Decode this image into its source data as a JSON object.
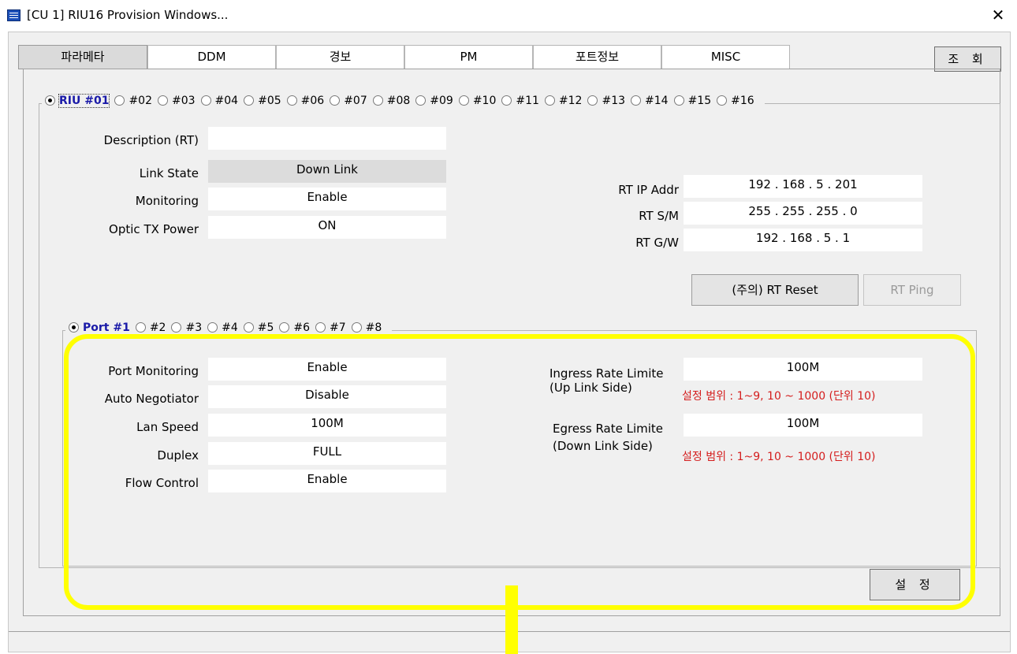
{
  "window": {
    "title": "[CU 1] RIU16 Provision Windows...",
    "close_glyph": "✕"
  },
  "tabs": [
    {
      "label": "파라메타",
      "active": true
    },
    {
      "label": "DDM",
      "active": false
    },
    {
      "label": "경보",
      "active": false
    },
    {
      "label": "PM",
      "active": false
    },
    {
      "label": "포트정보",
      "active": false
    },
    {
      "label": "MISC",
      "active": false
    }
  ],
  "toolbar": {
    "query_label": "조 회"
  },
  "riu_selector": {
    "selected": "RIU #01",
    "options": [
      "#02",
      "#03",
      "#04",
      "#05",
      "#06",
      "#07",
      "#08",
      "#09",
      "#10",
      "#11",
      "#12",
      "#13",
      "#14",
      "#15",
      "#16"
    ]
  },
  "rt_info": {
    "description_label": "Description (RT)",
    "description_value": "",
    "link_state_label": "Link State",
    "link_state_value": "Down Link",
    "monitoring_label": "Monitoring",
    "monitoring_value": "Enable",
    "optic_tx_label": "Optic TX Power",
    "optic_tx_value": "ON"
  },
  "network": {
    "ip_label": "RT IP Addr",
    "ip_value": "192 . 168 . 5 . 201",
    "sm_label": "RT S/M",
    "sm_value": "255 . 255 . 255 . 0",
    "gw_label": "RT G/W",
    "gw_value": "192 . 168 . 5 . 1"
  },
  "actions": {
    "reset_label": "(주의) RT Reset",
    "ping_label": "RT Ping",
    "apply_label": "설 정"
  },
  "port_selector": {
    "selected": "Port #1",
    "options": [
      "#2",
      "#3",
      "#4",
      "#5",
      "#6",
      "#7",
      "#8"
    ]
  },
  "port": {
    "monitoring_label": "Port Monitoring",
    "monitoring_value": "Enable",
    "autoneg_label": "Auto Negotiator",
    "autoneg_value": "Disable",
    "speed_label": "Lan Speed",
    "speed_value": "100M",
    "duplex_label": "Duplex",
    "duplex_value": "FULL",
    "flow_label": "Flow Control",
    "flow_value": "Enable"
  },
  "rate_limits": {
    "ingress_label_1": "Ingress Rate Limite",
    "ingress_label_2": "(Up Link Side)",
    "ingress_value": "100M",
    "egress_label_1": "Egress Rate Limite",
    "egress_label_2": "(Down Link Side)",
    "egress_value": "100M",
    "range_note": "설정 범위 : 1~9, 10 ~ 1000 (단위 10)"
  },
  "colors": {
    "highlight": "#ffff00",
    "selected_label": "#1a1aa8",
    "range_note": "#d41d1d"
  }
}
